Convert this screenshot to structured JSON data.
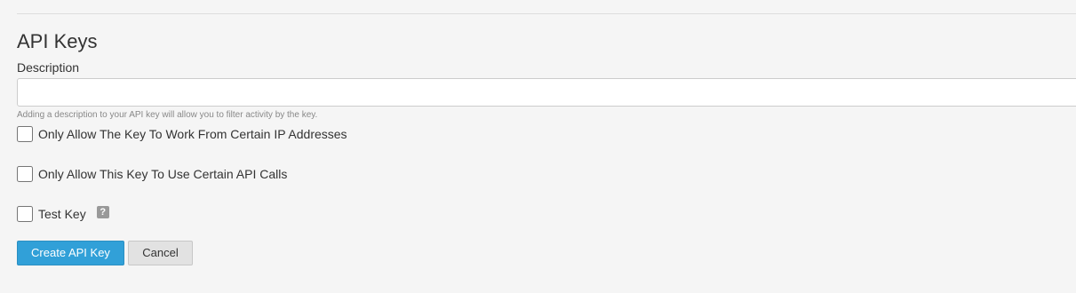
{
  "page": {
    "title": "API Keys"
  },
  "description": {
    "label": "Description",
    "value": "",
    "help_text": "Adding a description to your API key will allow you to filter activity by the key."
  },
  "options": {
    "ip_restriction_label": "Only Allow The Key To Work From Certain IP Addresses",
    "ip_restriction_checked": false,
    "api_calls_restriction_label": "Only Allow This Key To Use Certain API Calls",
    "api_calls_restriction_checked": false,
    "test_key_label": "Test Key",
    "test_key_checked": false,
    "test_key_help_glyph": "?"
  },
  "actions": {
    "create_label": "Create API Key",
    "cancel_label": "Cancel"
  },
  "colors": {
    "primary_button": "#31a0d8",
    "secondary_button": "#e2e2e2",
    "background": "#f5f5f5"
  },
  "icons": {
    "test_key_help": "question-mark-icon"
  }
}
